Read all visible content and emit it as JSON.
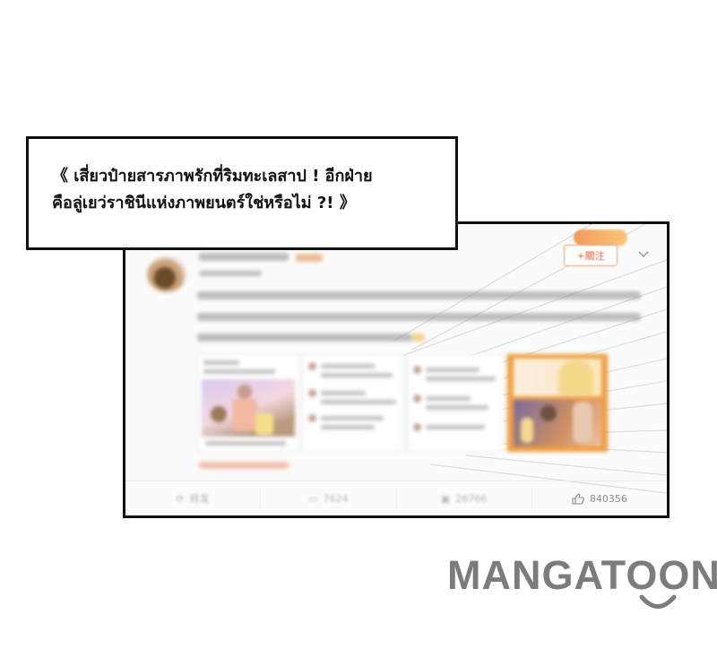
{
  "caption": {
    "line1": "《 เสี่ยวป๋ายสารภาพรักที่ริมทะเลสาป ! อีกฝ่าย",
    "line2": "คือลู่เยว่ราชินีแห่งภาพยนตร์ใช่หรือไม่ ?! 》"
  },
  "post": {
    "follow_label": "+關注",
    "stats": {
      "repost": "转发",
      "comments": "7624",
      "shares": "26766",
      "likes": "840356"
    }
  },
  "logo": {
    "text": "MANGATOON"
  },
  "colors": {
    "accent": "#e06030",
    "logo_gray": "#7c7c7c",
    "border": "#111111"
  }
}
